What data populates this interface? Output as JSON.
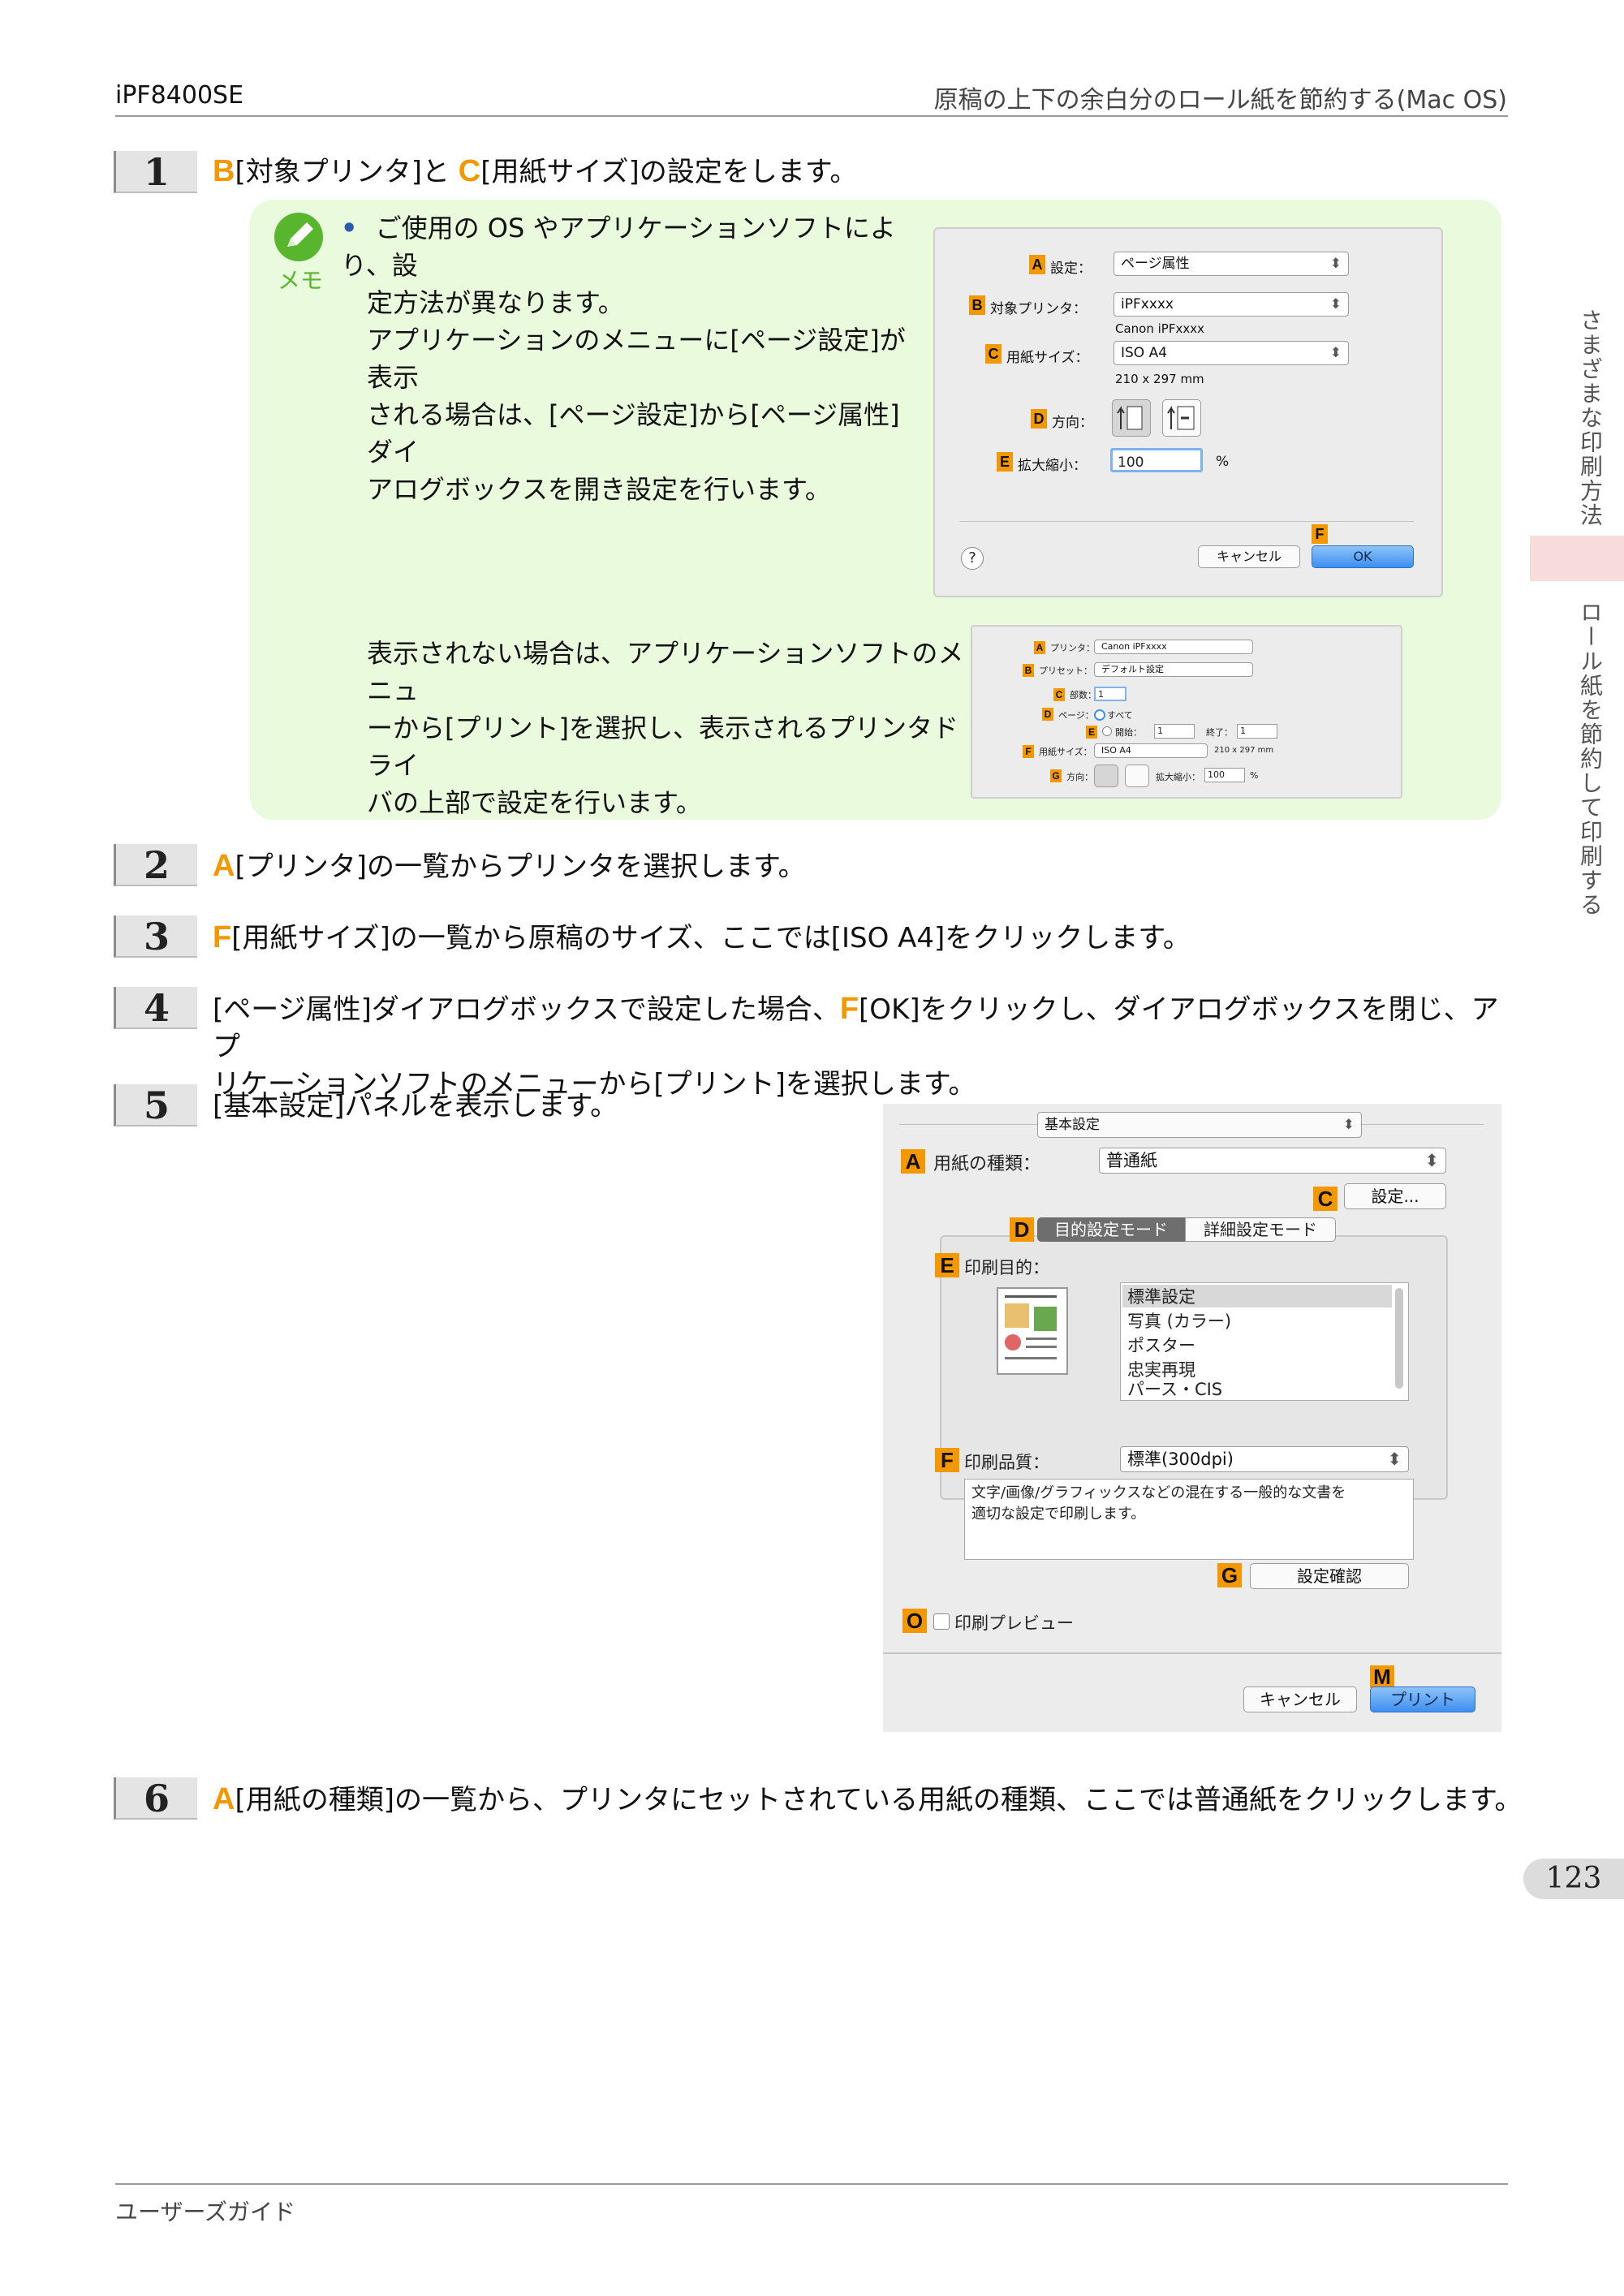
{
  "header": {
    "model": "iPF8400SE",
    "section_title": "原稿の上下の余白分のロール紙を節約する(Mac OS)"
  },
  "steps": [
    {
      "num": "1",
      "tag1": "B",
      "text1": "[対象プリンタ]と",
      "tag2": "C",
      "text2": "[用紙サイズ]の設定をします。"
    },
    {
      "num": "2",
      "tag1": "A",
      "text1": "[プリンタ]の一覧からプリンタを選択します。"
    },
    {
      "num": "3",
      "tag1": "F",
      "text1": "[用紙サイズ]の一覧から原稿のサイズ、ここでは[ISO A4]をクリックします。"
    },
    {
      "num": "4",
      "pre": "[ページ属性]ダイアログボックスで設定した場合、",
      "tag1": "F",
      "text1": "[OK]をクリックし、ダイアログボックスを閉じ、アプ",
      "text2": "リケーションソフトのメニューから[プリント]を選択します。"
    },
    {
      "num": "5",
      "text1": "[基本設定]パネルを表示します。"
    },
    {
      "num": "6",
      "tag1": "A",
      "text1": "[用紙の種類]の一覧から、プリンタにセットされている用紙の種類、ここでは普通紙をクリックします。"
    }
  ],
  "memo": {
    "label": "メモ",
    "bullet": "•",
    "para1_lines": [
      "ご使用の OS やアプリケーションソフトにより、設",
      "定方法が異なります。",
      "アプリケーションのメニューに[ページ設定]が表示",
      "される場合は、[ページ設定]から[ページ属性]ダイ",
      "アログボックスを開き設定を行います。"
    ],
    "para2_lines": [
      "表示されない場合は、アプリケーションソフトのメニュ",
      "ーから[プリント]を選択し、表示されるプリンタドライ",
      "バの上部で設定を行います。"
    ]
  },
  "page_setup_dialog": {
    "tags": {
      "a": "A",
      "b": "B",
      "c": "C",
      "d": "D",
      "e": "E",
      "f": "F"
    },
    "settings_label": "設定：",
    "settings_value": "ページ属性",
    "printer_label": "対象プリンタ：",
    "printer_value": "iPFxxxx",
    "printer_sub": "Canon iPFxxxx",
    "paper_label": "用紙サイズ：",
    "paper_value": "ISO A4",
    "paper_sub": "210 x 297 mm",
    "orient_label": "方向：",
    "scale_label": "拡大縮小：",
    "scale_value": "100",
    "scale_unit": "%",
    "help": "?",
    "cancel": "キャンセル",
    "ok": "OK",
    "arrow": "⬍"
  },
  "print_dialog_small": {
    "tags": {
      "a": "A",
      "b": "B",
      "c": "C",
      "d": "D",
      "e": "E",
      "f": "F",
      "g": "G"
    },
    "printer_label": "プリンタ：",
    "printer_value": "Canon iPFxxxx",
    "preset_label": "プリセット：",
    "preset_value": "デフォルト設定",
    "copies_label": "部数：",
    "copies_value": "1",
    "pages_label": "ページ：",
    "pages_all": "すべて",
    "pages_from": "開始：",
    "from_value": "1",
    "pages_to": "終了：",
    "to_value": "1",
    "paper_label": "用紙サイズ：",
    "paper_value": "ISO A4",
    "paper_sub": "210 x 297 mm",
    "orient_label": "方向：",
    "scale_label": "拡大縮小：",
    "scale_value": "100",
    "scale_unit": "%"
  },
  "basic_panel": {
    "tags": {
      "a": "A",
      "c": "C",
      "d": "D",
      "e": "E",
      "f": "F",
      "g": "G",
      "o": "O",
      "m": "M"
    },
    "panel_popup": "基本設定",
    "media_label": "用紙の種類：",
    "media_value": "普通紙",
    "settings_button": "設定...",
    "tab_mode": "目的設定モード",
    "tab_detail": "詳細設定モード",
    "purpose_label": "印刷目的：",
    "purpose_items": [
      "標準設定",
      "写真 (カラー)",
      "ポスター",
      "忠実再現",
      "パース・CIS"
    ],
    "quality_label": "印刷品質：",
    "quality_value": "標準(300dpi)",
    "description": [
      "文字/画像/グラフィックスなどの混在する一般的な文書を",
      "適切な設定で印刷します。"
    ],
    "confirm_button": "設定確認",
    "preview_label": "印刷プレビュー",
    "cancel": "キャンセル",
    "print": "プリント",
    "arrow": "⬍"
  },
  "side_tabs": {
    "upper": "さまざまな印刷方法",
    "lower": "ロール紙を節約して印刷する"
  },
  "page_number": "123",
  "footer": {
    "text": "ユーザーズガイド"
  },
  "colors": {
    "accent_orange": "#f39800",
    "memo_green_bg": "#e9fbdc",
    "memo_icon_green": "#58b52e",
    "ok_blue": "#3d8ff0"
  }
}
